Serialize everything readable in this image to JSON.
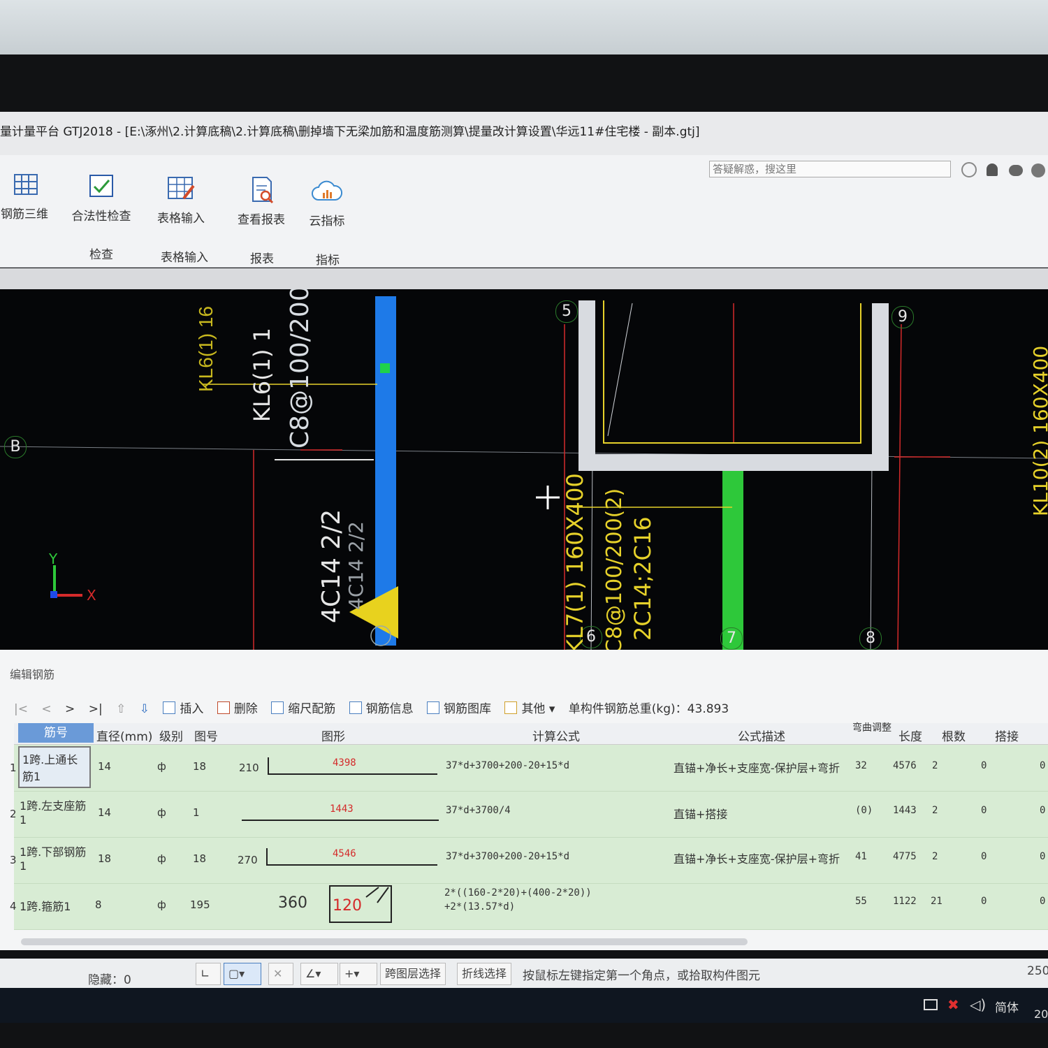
{
  "app": {
    "title": "量计量平台 GTJ2018 - [E:\\涿州\\2.计算底稿\\2.计算底稿\\删掉墙下无梁加筋和温度筋测算\\提量改计算设置\\华远11#住宅楼 - 副本.gtj]",
    "search_placeholder": "答疑解惑，搜这里"
  },
  "ribbon": {
    "buttons": [
      {
        "label": "钢筋三维",
        "icon": "rebar-3d-icon"
      },
      {
        "label": "合法性检查",
        "icon": "check-icon"
      },
      {
        "label": "表格输入",
        "icon": "table-input-icon"
      },
      {
        "label": "查看报表",
        "icon": "report-icon"
      },
      {
        "label": "云指标",
        "icon": "cloud-chart-icon"
      }
    ],
    "groups": [
      "检查",
      "表格输入",
      "报表",
      "指标"
    ]
  },
  "cad": {
    "axis_labels": [
      "B",
      "5",
      "9",
      "6",
      "7",
      "8"
    ],
    "annotations": {
      "kl6_small": "KL6(1) 16",
      "kl6_big": "KL6(1) 1",
      "stirrup_left": "C8@100/200",
      "bottom_bars": "4C14 2/2",
      "bottom_bars_small": "4C14 2/2",
      "kl7": "KL7(1) 160X400",
      "stirrup_right": "C8@100/200(2)",
      "top_bars": "2C14;2C16",
      "right_edge": "KL10(2) 160X400"
    },
    "ucs": {
      "x": "X",
      "y": "Y"
    }
  },
  "edit_panel": {
    "title": "编辑钢筋",
    "toolbar": {
      "insert": "插入",
      "delete": "删除",
      "scale": "缩尺配筋",
      "info": "钢筋信息",
      "library": "钢筋图库",
      "other": "其他",
      "total_weight": "单构件钢筋总重(kg)：43.893"
    },
    "columns": [
      "筋号",
      "直径(mm)",
      "级别",
      "图号",
      "图形",
      "计算公式",
      "公式描述",
      "弯曲调整",
      "长度",
      "根数",
      "搭接"
    ],
    "rows": [
      {
        "no": "1",
        "name": "1跨.上通长筋1",
        "dia": "14",
        "grade": "ф",
        "fig": "18",
        "left": "210",
        "mid": "4398",
        "formula": "37*d+3700+200-20+15*d",
        "desc": "直锚+净长+支座宽-保护层+弯折",
        "bend": "32",
        "length": "4576",
        "count": "2",
        "lap": "0",
        "extra": "0"
      },
      {
        "no": "2",
        "name": "1跨.左支座筋1",
        "dia": "14",
        "grade": "ф",
        "fig": "1",
        "left": "",
        "mid": "1443",
        "formula": "37*d+3700/4",
        "desc": "直锚+搭接",
        "bend": "(0)",
        "length": "1443",
        "count": "2",
        "lap": "0",
        "extra": "0"
      },
      {
        "no": "3",
        "name": "1跨.下部钢筋1",
        "dia": "18",
        "grade": "ф",
        "fig": "18",
        "left": "270",
        "mid": "4546",
        "formula": "37*d+3700+200-20+15*d",
        "desc": "直锚+净长+支座宽-保护层+弯折",
        "bend": "41",
        "length": "4775",
        "count": "2",
        "lap": "0",
        "extra": "0"
      },
      {
        "no": "4",
        "name": "1跨.箍筋1",
        "dia": "8",
        "grade": "ф",
        "fig": "195",
        "left": "360",
        "mid": "120",
        "formula": "2*((160-2*20)+(400-2*20))+2*(13.57*d)",
        "formula_line1": "2*((160-2*20)+(400-2*20))",
        "formula_line2": "+2*(13.57*d)",
        "desc": "",
        "bend": "55",
        "length": "1122",
        "count": "21",
        "lap": "0",
        "extra": "0"
      }
    ]
  },
  "status": {
    "hidden": "隐藏：0",
    "cross_layer": "跨图层选择",
    "polyline": "折线选择",
    "hint": "按鼠标左键指定第一个角点，或拾取构件图元",
    "right_value": "250"
  },
  "taskbar": {
    "ime": "简体",
    "clock": "20"
  }
}
